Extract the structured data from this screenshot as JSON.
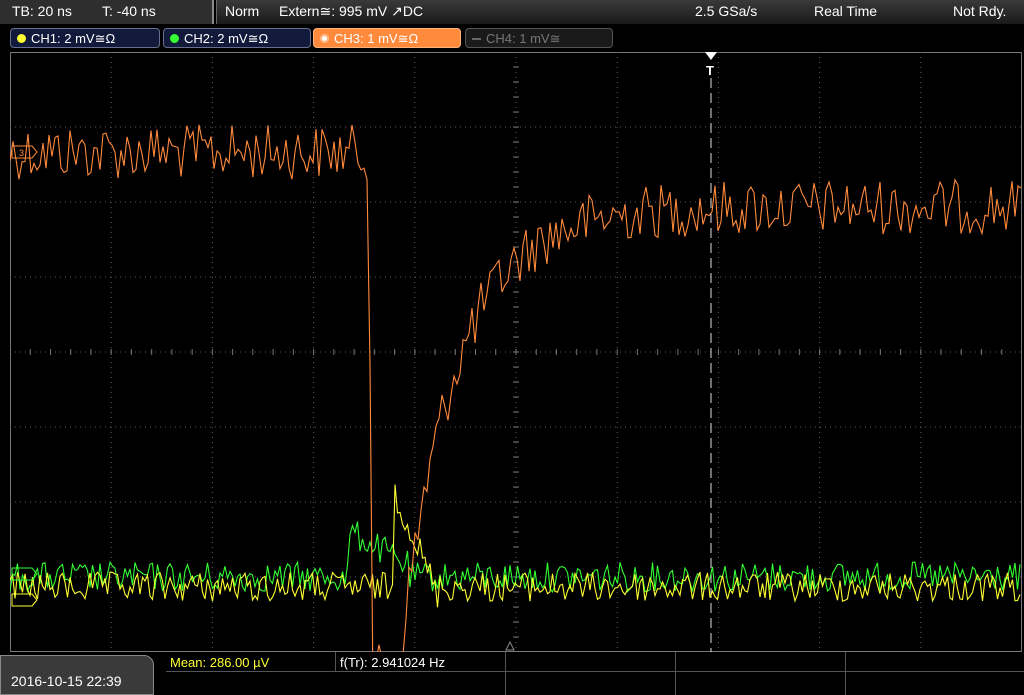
{
  "status": {
    "timebase": "TB: 20 ns",
    "trigger_time": "T: -40 ns",
    "trigger_mode": "Norm",
    "trigger_source": "Extern≅: 995 mV ↗DC",
    "sample_rate": "2.5 GSa/s",
    "acq_mode": "Real Time",
    "trigger_state": "Not Rdy."
  },
  "channels": [
    {
      "label": "CH1: 2 mV≅Ω",
      "color": "#ffff33",
      "active": true
    },
    {
      "label": "CH2: 2 mV≅Ω",
      "color": "#33ff33",
      "active": true
    },
    {
      "label": "CH3: 1 mV≅Ω",
      "color": "#ff8a3c",
      "active": true,
      "selected": true
    },
    {
      "label": "CH4: 1 mV≅",
      "color": "#777777",
      "active": false
    }
  ],
  "ch3_marker": "3",
  "trigger_marker": "T",
  "datetime": "2016-10-15 22:39",
  "measurements": {
    "mean": "Mean: 286.00 µV",
    "frequency": "f(Tr): 2.941024 Hz"
  },
  "colors": {
    "ch1": "#ffff33",
    "ch2": "#33ff33",
    "ch3": "#ff8a3c",
    "grid": "#5a5a5a"
  }
}
